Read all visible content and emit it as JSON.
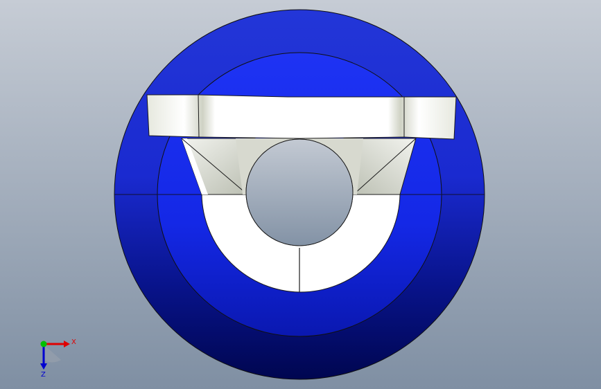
{
  "view": {
    "background_top": "#c6ccd5",
    "background_bottom": "#7f8fa3"
  },
  "model": {
    "colors": {
      "outer_ring_light": "#2a3de0",
      "outer_ring_dark": "#00085a",
      "inner_ring": "#1b2ff2",
      "inner_ring_dark": "#0010a8",
      "part_white": "#ffffff",
      "part_shade": "#c8ccc0",
      "edge": "#1a1a1a"
    }
  },
  "triad": {
    "x_label": "X",
    "z_label": "Z",
    "x_color": "#e00000",
    "y_color": "#00c000",
    "z_color": "#0000d0"
  }
}
